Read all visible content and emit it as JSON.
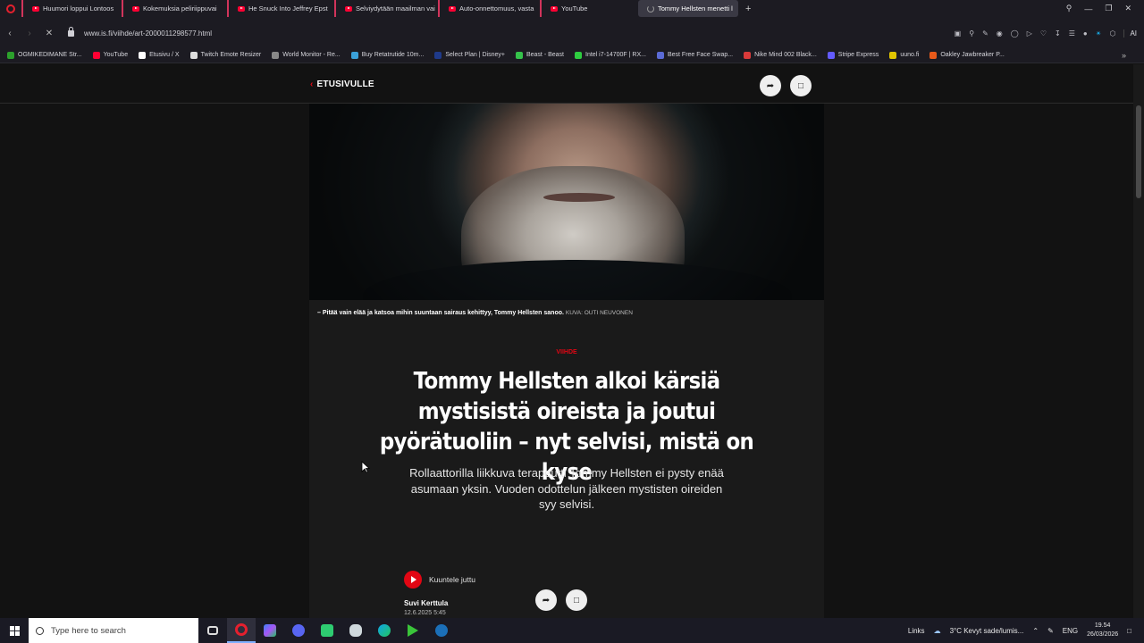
{
  "browser": {
    "tabs": [
      {
        "label": "Huumori loppui Lontoos",
        "type": "youtube"
      },
      {
        "label": "Kokemuksia peliriippuvai",
        "type": "youtube"
      },
      {
        "label": "He Snuck Into Jeffrey Epst",
        "type": "youtube"
      },
      {
        "label": "Selviydytään maailman vai",
        "type": "youtube"
      },
      {
        "label": "Auto-onnettomuus, vasta",
        "type": "youtube"
      },
      {
        "label": "YouTube",
        "type": "youtube"
      },
      {
        "label": "Tommy Hellsten menetti l",
        "type": "active"
      }
    ],
    "url": "www.is.fi/viihde/art-2000011298577.html",
    "ai_label": "AI",
    "bookmarks": [
      {
        "label": "OGMIKEDIMANE Str...",
        "color": "#2ca02c"
      },
      {
        "label": "YouTube",
        "color": "#ff0033"
      },
      {
        "label": "Etusivu / X",
        "color": "#ffffff"
      },
      {
        "label": "Twitch Emote Resizer",
        "color": "#dddddd"
      },
      {
        "label": "World Monitor - Re...",
        "color": "#888888"
      },
      {
        "label": "Buy Retatrutide 10m...",
        "color": "#3aa0d8"
      },
      {
        "label": "Select Plan | Disney+",
        "color": "#1f3a8a"
      },
      {
        "label": "Beast - Beast",
        "color": "#35c24b"
      },
      {
        "label": "Intel i7-14700F | RX...",
        "color": "#2ecc40"
      },
      {
        "label": "Best Free Face Swap...",
        "color": "#5b6bd6"
      },
      {
        "label": "Nike Mind 002 Black...",
        "color": "#d93a3a"
      },
      {
        "label": "Stripe Express",
        "color": "#635bff"
      },
      {
        "label": "uuno.fi",
        "color": "#e0c400"
      },
      {
        "label": "Oakley Jawbreaker P...",
        "color": "#e85a1a"
      }
    ]
  },
  "page": {
    "back_label": "ETUSIVULLE",
    "caption_text": "– Pitää vain elää ja katsoa mihin suuntaan sairaus kehittyy, Tommy Hellsten sanoo.",
    "caption_credit": "KUVA: OUTI NEUVONEN",
    "section": "VIIHDE",
    "headline": "Tommy Hellsten alkoi kärsiä mystisistä oireista ja joutui pyörätuoliin – nyt selvisi, mistä on kyse",
    "lead": "Rollaattorilla liikkuva terapeutti Tommy Hellsten ei pysty enää asumaan yksin. Vuoden odottelun jälkeen mystisten oireiden syy selvisi.",
    "listen_label": "Kuuntele juttu",
    "author": "Suvi Kerttula",
    "date": "12.6.2025 5:45"
  },
  "taskbar": {
    "search_placeholder": "Type here to search",
    "links_label": "Links",
    "weather": "3°C  Kevyt sade/lumis...",
    "lang": "ENG",
    "time": "19.54",
    "date": "26/03/2026"
  },
  "colors": {
    "accent": "#e20613",
    "background": "#121212",
    "article_bg": "#1a1a1a"
  }
}
